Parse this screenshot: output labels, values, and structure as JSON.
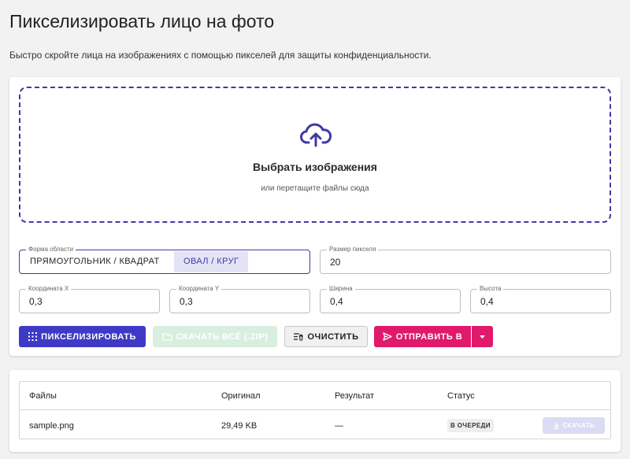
{
  "header": {
    "title": "Пикселизировать лицо на фото",
    "description": "Быстро скройте лица на изображениях с помощью пикселей для защиты конфиденциальности."
  },
  "dropzone": {
    "icon": "cloud-upload-icon",
    "title": "Выбрать изображения",
    "subtitle": "или перетащите файлы сюда"
  },
  "settings": {
    "shape": {
      "label": "Форма области",
      "options": [
        "ПРЯМОУГОЛЬНИК / КВАДРАТ",
        "ОВАЛ / КРУГ"
      ],
      "selected": "ОВАЛ / КРУГ"
    },
    "pixel_size": {
      "label": "Размер пикселя",
      "value": "20"
    },
    "x": {
      "label": "Координата X",
      "value": "0,3"
    },
    "y": {
      "label": "Координата Y",
      "value": "0,3"
    },
    "width": {
      "label": "Ширина",
      "value": "0,4"
    },
    "height": {
      "label": "Высота",
      "value": "0,4"
    }
  },
  "actions": {
    "pixelate": "ПИКСЕЛИЗИРОВАТЬ",
    "download_zip": "СКАЧАТЬ ВСЁ (.ZIP)",
    "clear": "ОЧИСТИТЬ",
    "send": "ОТПРАВИТЬ В"
  },
  "colors": {
    "accent": "#3f3ac6",
    "send": "#e0196b",
    "zip_disabled": "#d8efe0"
  },
  "table": {
    "columns": [
      "Файлы",
      "Оригинал",
      "Результат",
      "Статус"
    ],
    "rows": [
      {
        "file": "sample.png",
        "original": "29,49 KB",
        "result": "—",
        "status": "В ОЧЕРЕДИ",
        "download": "СКАЧАТЬ"
      }
    ]
  }
}
